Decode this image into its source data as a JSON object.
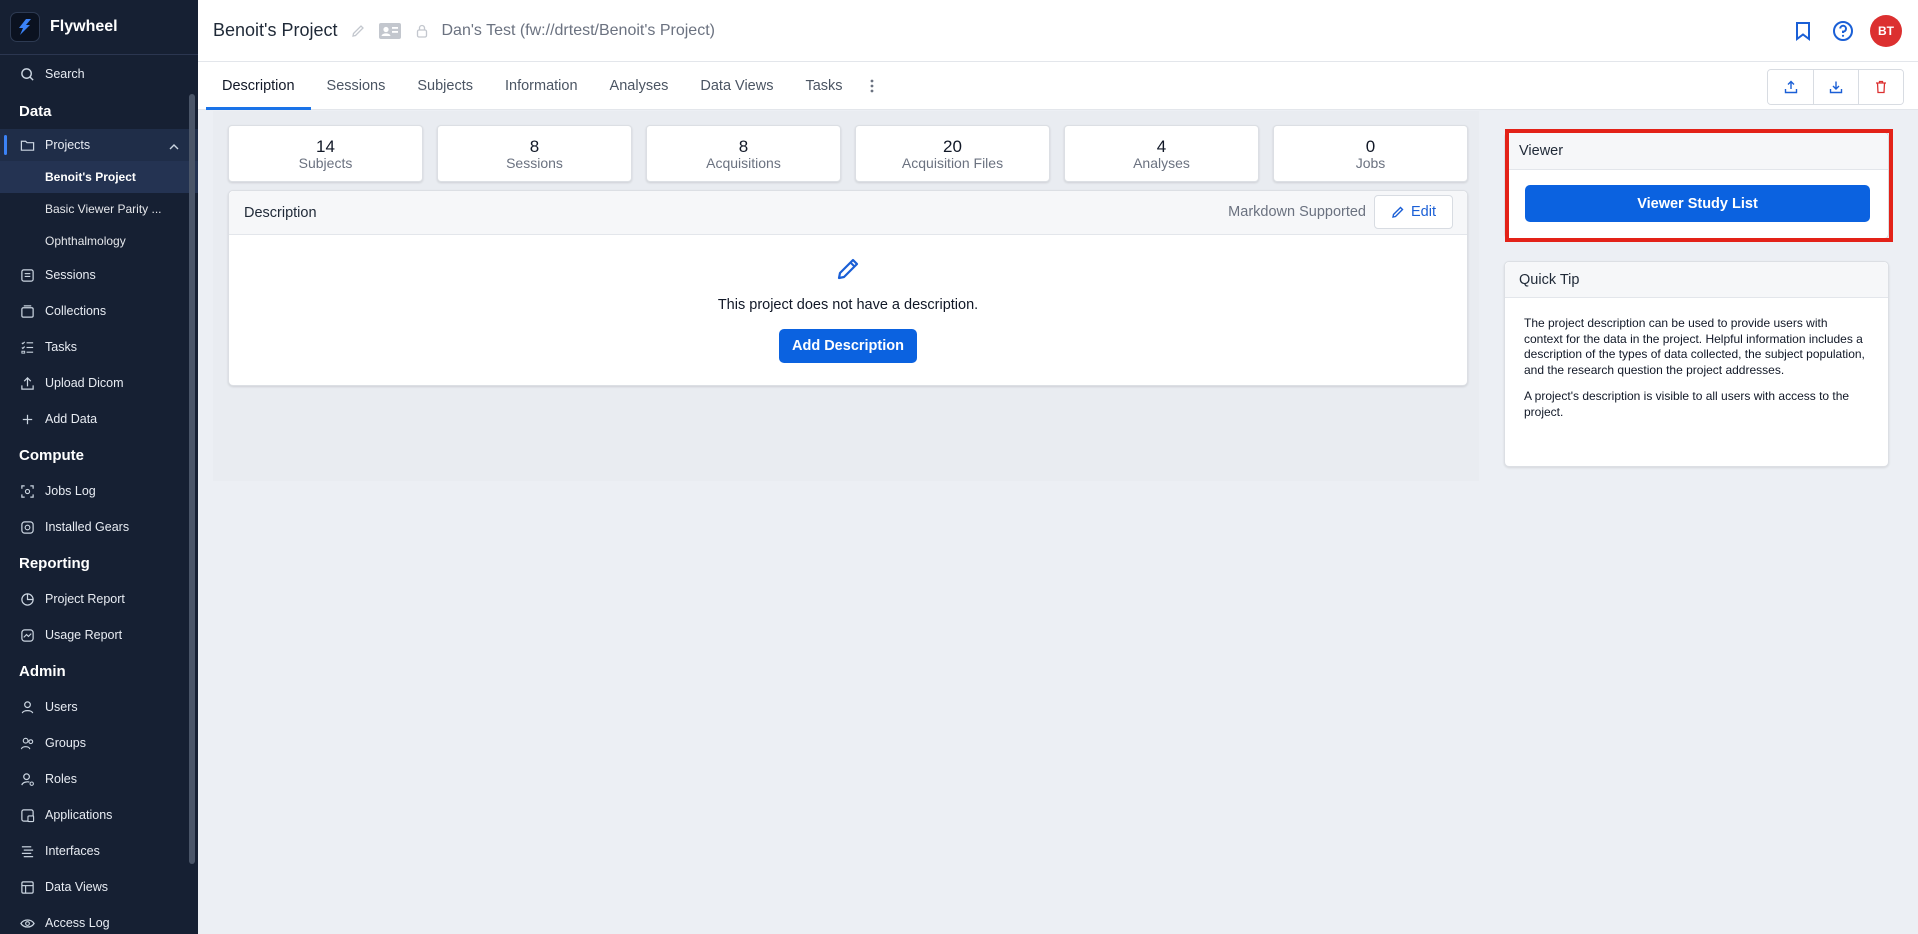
{
  "brand": {
    "name": "Flywheel"
  },
  "sidebar": {
    "search_label": "Search",
    "sections": {
      "data": "Data",
      "compute": "Compute",
      "reporting": "Reporting",
      "admin": "Admin"
    },
    "projects_label": "Projects",
    "project_items": [
      "Benoit's Project",
      "Basic Viewer Parity ...",
      "Ophthalmology"
    ],
    "data_items": [
      "Sessions",
      "Collections",
      "Tasks",
      "Upload Dicom",
      "Add Data"
    ],
    "compute_items": [
      "Jobs Log",
      "Installed Gears"
    ],
    "reporting_items": [
      "Project Report",
      "Usage Report"
    ],
    "admin_items": [
      "Users",
      "Groups",
      "Roles",
      "Applications",
      "Interfaces",
      "Data Views",
      "Access Log"
    ]
  },
  "header": {
    "title": "Benoit's Project",
    "path": "Dan's Test (fw://drtest/Benoit's Project)",
    "avatar_initials": "BT"
  },
  "tabs": [
    "Description",
    "Sessions",
    "Subjects",
    "Information",
    "Analyses",
    "Data Views",
    "Tasks"
  ],
  "stats": [
    {
      "value": "14",
      "label": "Subjects"
    },
    {
      "value": "8",
      "label": "Sessions"
    },
    {
      "value": "8",
      "label": "Acquisitions"
    },
    {
      "value": "20",
      "label": "Acquisition Files"
    },
    {
      "value": "4",
      "label": "Analyses"
    },
    {
      "value": "0",
      "label": "Jobs"
    }
  ],
  "description": {
    "title": "Description",
    "markdown_label": "Markdown Supported",
    "edit_label": "Edit",
    "empty_text": "This project does not have a description.",
    "add_label": "Add Description"
  },
  "viewer": {
    "title": "Viewer",
    "button_label": "Viewer Study List"
  },
  "quick_tip": {
    "title": "Quick Tip",
    "paragraph1": "The project description can be used to provide users with context for the data in the project. Helpful information includes a description of the types of data collected, the subject population, and the research question the project addresses.",
    "paragraph2": "A project's description is visible to all users with access to the project."
  },
  "colors": {
    "sidebar_bg": "#162033",
    "accent": "#0b62e0",
    "highlight": "#e32218",
    "avatar": "#dc3030"
  }
}
